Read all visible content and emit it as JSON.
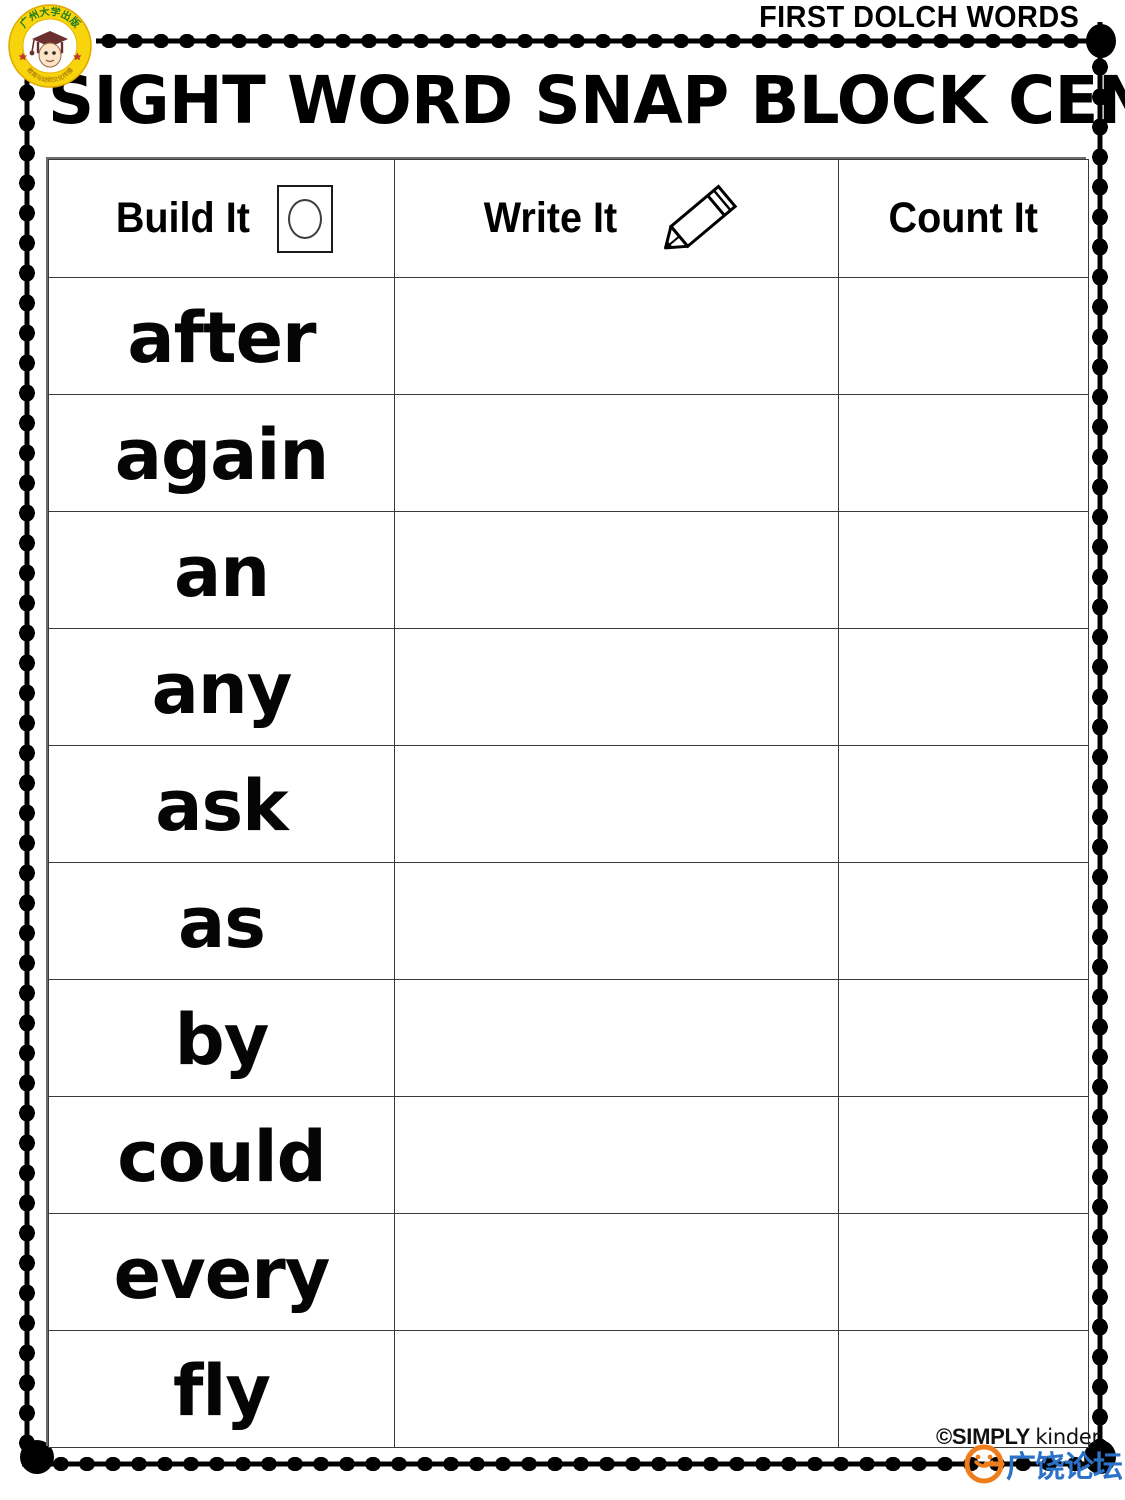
{
  "header": {
    "collection_label": "FIRST DOLCH WORDS",
    "title": "SIGHT WORD SNAP BLOCK CENTER"
  },
  "logo": {
    "name": "site-logo",
    "ring_color": "#f5cf0a",
    "text_color": "#1e7a1e",
    "cap_color": "#6b2f2f",
    "top_text": "广州大学出版",
    "bottom_text": "教育与幼师文化传播"
  },
  "table": {
    "columns": [
      {
        "key": "build",
        "label": "Build It",
        "icon": "snap-block-icon"
      },
      {
        "key": "write",
        "label": "Write It",
        "icon": "pencil-icon"
      },
      {
        "key": "count",
        "label": "Count It",
        "icon": ""
      }
    ],
    "rows": [
      {
        "word": "after",
        "write": "",
        "count": ""
      },
      {
        "word": "again",
        "write": "",
        "count": ""
      },
      {
        "word": "an",
        "write": "",
        "count": ""
      },
      {
        "word": "any",
        "write": "",
        "count": ""
      },
      {
        "word": "ask",
        "write": "",
        "count": ""
      },
      {
        "word": "as",
        "write": "",
        "count": ""
      },
      {
        "word": "by",
        "write": "",
        "count": ""
      },
      {
        "word": "could",
        "write": "",
        "count": ""
      },
      {
        "word": "every",
        "write": "",
        "count": ""
      },
      {
        "word": "fly",
        "write": "",
        "count": ""
      }
    ]
  },
  "footer": {
    "copyright_symbol": "©",
    "brand_bold": "SIMPLY",
    "brand_light": "kinder"
  },
  "watermark": {
    "text": "广饶论坛",
    "mark_color": "#f07d1c",
    "text_color": "#2c72c8"
  },
  "colors": {
    "ink": "#000000",
    "table_border": "#3a3a3a",
    "table_outer": "#6d6d6d",
    "paper": "#ffffff"
  }
}
